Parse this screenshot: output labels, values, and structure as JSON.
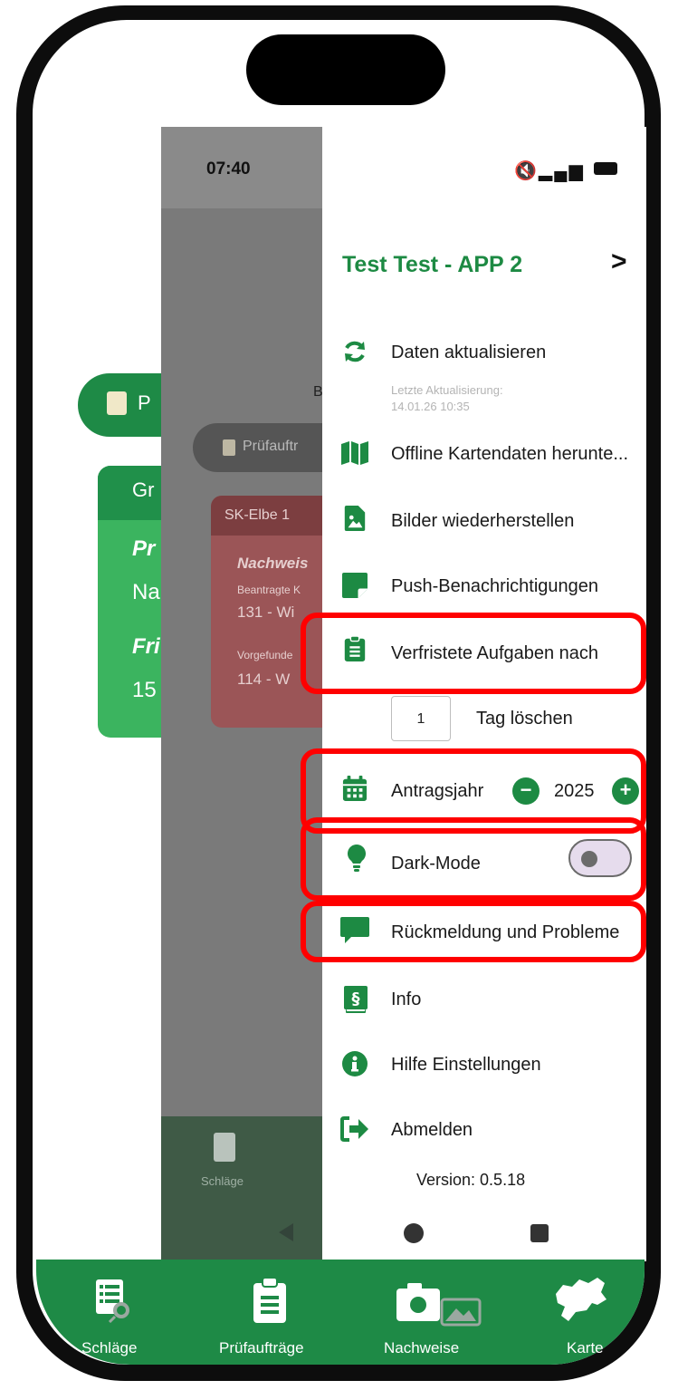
{
  "background_app": {
    "chip_text": "P",
    "card_title": "Gr",
    "card_line1": "Pr",
    "card_line2": "Na",
    "card_line3": "Fri",
    "card_line4": "15"
  },
  "inner_screen": {
    "time": "07:40",
    "partial_letter": "B",
    "pill_text": "Prüfauftr",
    "card_title": "SK-Elbe 1",
    "card_heading": "Nachweis",
    "card_label1": "Beantragte K",
    "card_value1": "131 - Wi",
    "card_label2": "Vorgefunde",
    "card_value2": "114 - W",
    "bottom_label": "Schläge"
  },
  "drawer": {
    "user_name": "Test Test - APP 2",
    "chevron": ">",
    "refresh_label": "Daten aktualisieren",
    "last_update_label": "Letzte Aktualisierung:",
    "last_update_value": "14.01.26 10:35",
    "offline_maps_label": "Offline Kartendaten herunte...",
    "restore_images_label": "Bilder wiederherstellen",
    "push_label": "Push-Benachrichtigungen",
    "expired_tasks_label": "Verfristete Aufgaben nach",
    "expired_days_value": "1",
    "expired_days_suffix": "Tag löschen",
    "application_year_label": "Antragsjahr",
    "application_year_value": "2025",
    "dark_mode_label": "Dark-Mode",
    "dark_mode_on": false,
    "feedback_label": "Rückmeldung und Probleme",
    "info_label": "Info",
    "help_label": "Hilfe Einstellungen",
    "logout_label": "Abmelden",
    "version_text": "Version: 0.5.18"
  },
  "bottom_nav": {
    "items": [
      {
        "label": "Schläge",
        "icon": "fields-list-icon"
      },
      {
        "label": "Prüfaufträge",
        "icon": "clipboard-icon"
      },
      {
        "label": "Nachweise",
        "icon": "camera-photo-icon"
      },
      {
        "label": "Karte",
        "icon": "map-region-icon"
      }
    ]
  },
  "colors": {
    "brand_green": "#1e8a46",
    "highlight_red": "#ff0000",
    "frame": "#0d0d0d"
  }
}
